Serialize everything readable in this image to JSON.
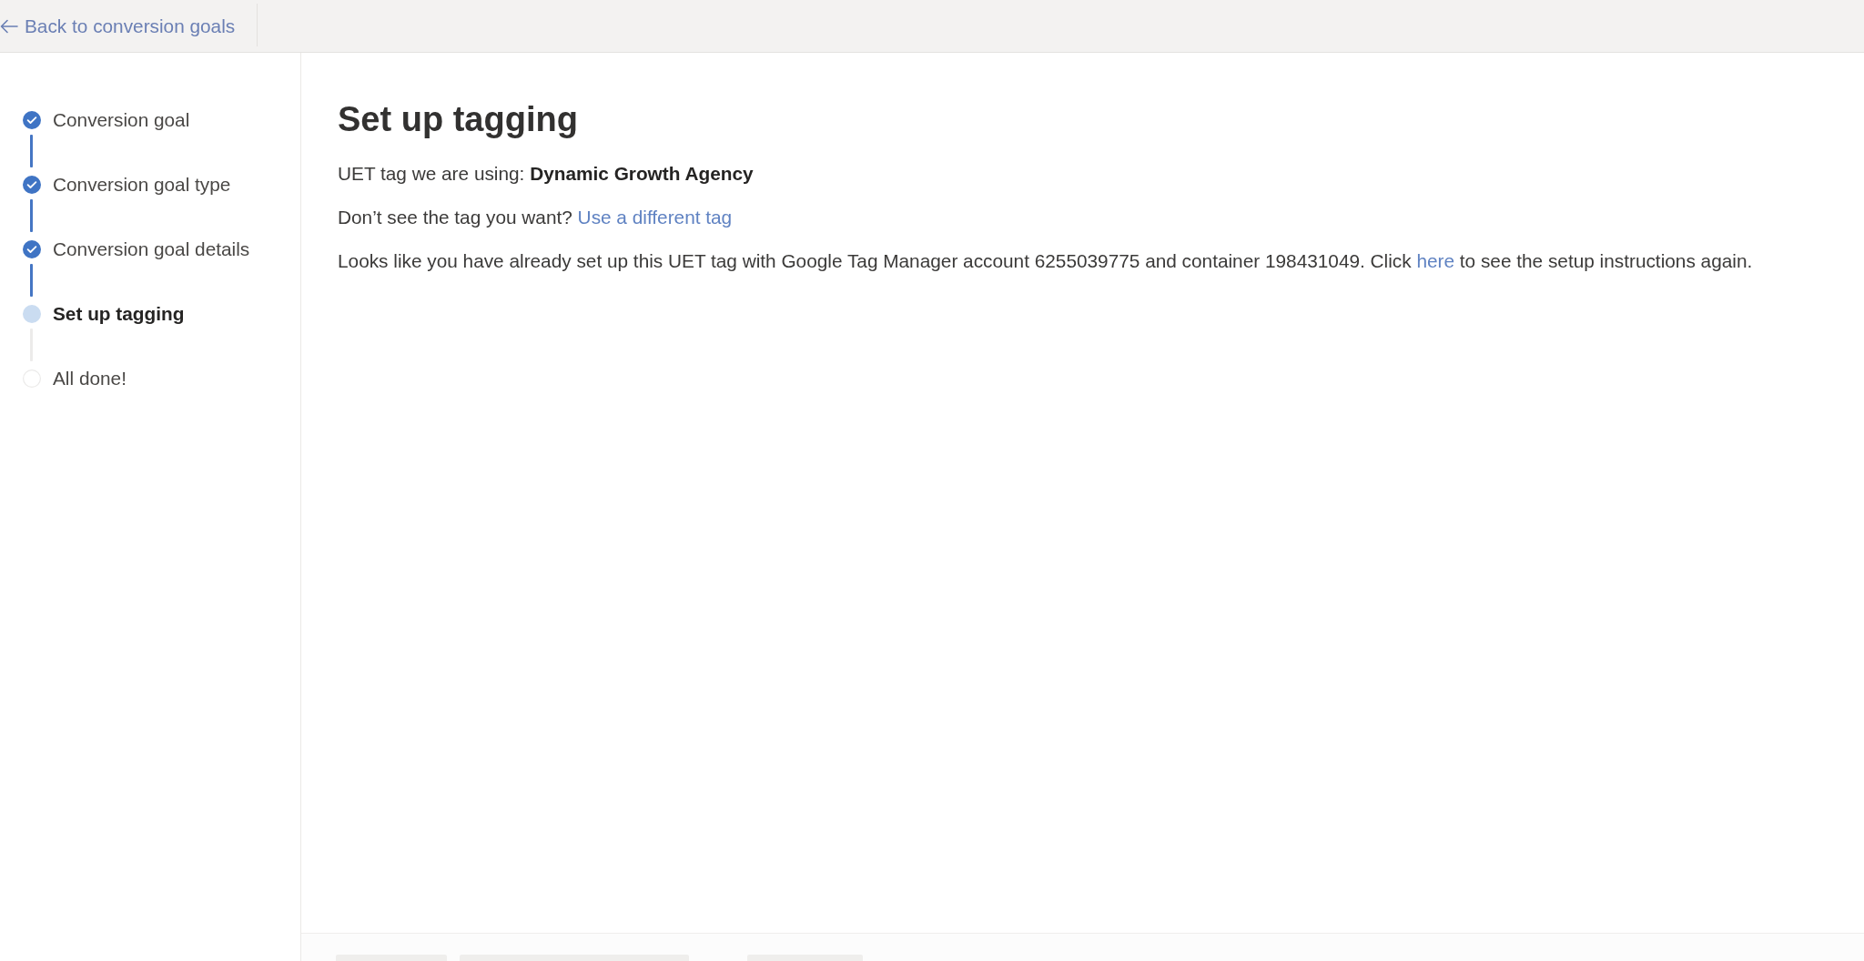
{
  "top_bar": {
    "back_link": "Back to conversion goals"
  },
  "steps": [
    {
      "label": "Conversion goal",
      "completed": true,
      "current": false
    },
    {
      "label": "Conversion goal type",
      "completed": true,
      "current": false
    },
    {
      "label": "Conversion goal details",
      "completed": true,
      "current": false
    },
    {
      "label": "Set up tagging",
      "completed": false,
      "current": true
    },
    {
      "label": "All done!",
      "completed": false,
      "current": false
    }
  ],
  "main": {
    "title": "Set up tagging",
    "paragraphs": [
      {
        "parts": [
          {
            "kind": "text",
            "text": "UET tag we are using: **Dynamic Growth Agency**"
          }
        ]
      },
      {
        "parts": [
          {
            "kind": "text",
            "text": "Don’t see the tag you want?"
          },
          {
            "kind": "link",
            "text": "Use a different tag"
          }
        ]
      },
      {
        "parts": [
          {
            "kind": "text",
            "text": "Looks like you have already set up this UET tag with Google Tag Manager account 6255039775 and container 198431049. Click"
          },
          {
            "kind": "link",
            "text": "here"
          },
          {
            "kind": "text",
            "text": "to see the setup instructions again."
          }
        ]
      }
    ]
  }
}
